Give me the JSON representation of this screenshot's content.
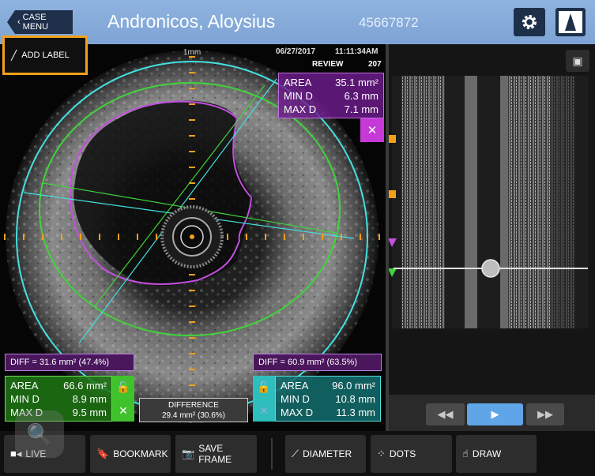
{
  "header": {
    "case_menu_label": "CASE MENU",
    "patient_name": "Andronicos, Aloysius",
    "patient_id": "45667872"
  },
  "ivus": {
    "add_label": "ADD LABEL",
    "scale": "1mm",
    "date": "06/27/2017",
    "time": "11:11:34AM",
    "mode": "REVIEW",
    "frame": "207",
    "lumen_box": {
      "area_label": "AREA",
      "area": "35.1 mm²",
      "min_label": "MIN D",
      "min": "6.3 mm",
      "max_label": "MAX D",
      "max": "7.1 mm"
    },
    "diff_left": "DIFF = 31.6 mm² (47.4%)",
    "diff_right": "DIFF = 60.9 mm² (63.5%)",
    "green_box": {
      "area_label": "AREA",
      "area": "66.6 mm²",
      "min_label": "MIN D",
      "min": "8.9 mm",
      "max_label": "MAX D",
      "max": "9.5 mm"
    },
    "cyan_box": {
      "area_label": "AREA",
      "area": "96.0 mm²",
      "min_label": "MIN D",
      "min": "10.8 mm",
      "max_label": "MAX D",
      "max": "11.3 mm"
    },
    "difference_title": "DIFFERENCE",
    "difference_value": "29.4 mm² (30.6%)"
  },
  "toolbar": {
    "live": "LIVE",
    "bookmark": "BOOKMARK",
    "save_frame": "SAVE FRAME",
    "diameter": "DIAMETER",
    "dots": "DOTS",
    "draw": "DRAW"
  },
  "colors": {
    "header": "#7ea4d5",
    "lumen": "#c34fe0",
    "vessel_green": "#3fd43a",
    "vessel_cyan": "#45e0e0",
    "marker_orange": "#f3a019"
  }
}
